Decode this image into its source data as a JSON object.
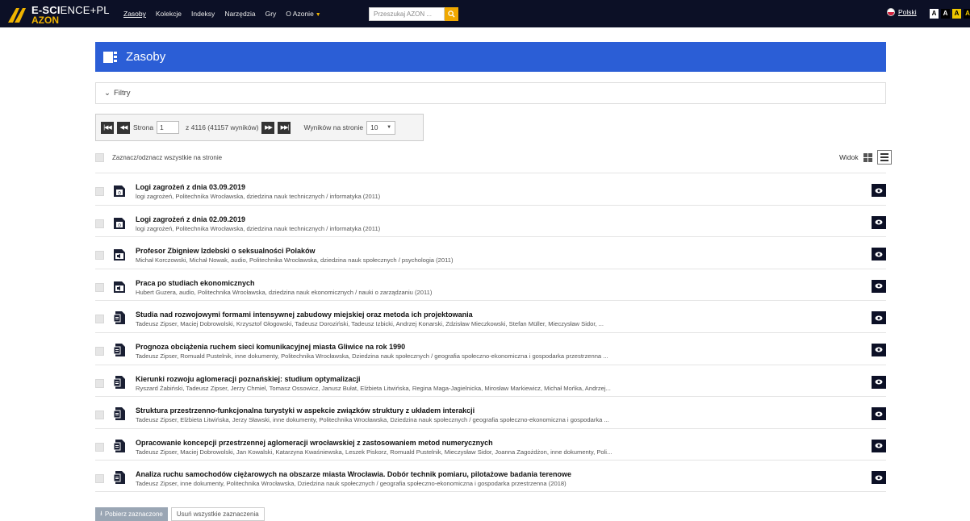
{
  "brand": {
    "name_bold": "E-SCI",
    "name_thin": "ENCE+PL",
    "sub": "AZON"
  },
  "nav": [
    {
      "label": "Zasoby",
      "active": true
    },
    {
      "label": "Kolekcje"
    },
    {
      "label": "Indeksy"
    },
    {
      "label": "Narzędzia"
    },
    {
      "label": "Gry"
    },
    {
      "label": "O Azonie"
    }
  ],
  "search": {
    "placeholder": "Przeszukaj AZON ..."
  },
  "language": "Polski",
  "font_sizes": [
    "A",
    "A",
    "A",
    "A"
  ],
  "section": {
    "title": "Zasoby"
  },
  "filters": {
    "label": "Filtry"
  },
  "pager": {
    "page_label": "Strona",
    "page_value": "1",
    "of_text": "z 4116 (41157 wyników)",
    "per_page_label": "Wyników na stronie",
    "per_page_value": "10"
  },
  "select_all": "Zaznacz/odznacz wszystkie na stronie",
  "view_label": "Widok",
  "results": [
    {
      "icon": "data-file-icon",
      "title": "Logi zagrożeń z dnia 03.09.2019",
      "meta": "logi zagrożeń, Politechnika Wrocławska, dziedzina nauk technicznych / informatyka (2011)"
    },
    {
      "icon": "data-file-icon",
      "title": "Logi zagrożeń z dnia 02.09.2019",
      "meta": "logi zagrożeń, Politechnika Wrocławska, dziedzina nauk technicznych / informatyka (2011)"
    },
    {
      "icon": "audio-file-icon",
      "title": "Profesor Zbigniew Izdebski o seksualności Polaków",
      "meta": "Michał Korczowski, Michał Nowak, audio, Politechnika Wrocławska, dziedzina nauk społecznych / psychologia (2011)"
    },
    {
      "icon": "audio-file-icon",
      "title": "Praca po studiach ekonomicznych",
      "meta": "Hubert Guzera, audio, Politechnika Wrocławska, dziedzina nauk ekonomicznych / nauki o zarządzaniu (2011)"
    },
    {
      "icon": "document-icon",
      "title": "Studia nad rozwojowymi formami intensywnej zabudowy miejskiej oraz metoda ich projektowania",
      "meta": "Tadeusz Zipser, Maciej Dobrowolski, Krzysztof Głogowski, Tadeusz Doroziński, Tadeusz Izbicki, Andrzej Konarski, Zdzisław Mieczkowski, Stefan Müller, Mieczysław Sidor, ..."
    },
    {
      "icon": "document-icon",
      "title": "Prognoza obciążenia ruchem sieci komunikacyjnej miasta Gliwice na rok 1990",
      "meta": "Tadeusz Zipser, Romuald Pustelnik, inne dokumenty, Politechnika Wrocławska, Dziedzina nauk społecznych / geografia społeczno-ekonomiczna i gospodarka przestrzenna ..."
    },
    {
      "icon": "document-icon",
      "title": "Kierunki rozwoju aglomeracji poznańskiej: studium optymalizacji",
      "meta": "Ryszard Żabiński, Tadeusz Zipser, Jerzy Chmiel, Tomasz Ossowicz, Janusz Bułat, Elżbieta Litwińska, Regina Maga-Jagielnicka, Mirosław Markiewicz, Michał Mońka, Andrzej..."
    },
    {
      "icon": "document-icon",
      "title": "Struktura przestrzenno-funkcjonalna turystyki w aspekcie związków struktury z układem interakcji",
      "meta": "Tadeusz Zipser, Elżbieta Litwińska, Jerzy Sławski, inne dokumenty, Politechnika Wrocławska, Dziedzina nauk społecznych / geografia społeczno-ekonomiczna i gospodarka ..."
    },
    {
      "icon": "document-icon",
      "title": "Opracowanie koncepcji przestrzennej aglomeracji wrocławskiej z zastosowaniem metod numerycznych",
      "meta": "Tadeusz Zipser, Maciej Dobrowolski, Jan Kowalski, Katarzyna Kwaśniewska, Leszek Piskorz, Romuald Pustelnik, Mieczysław Sidor, Joanna Zagożdżon, inne dokumenty, Poli..."
    },
    {
      "icon": "document-icon",
      "title": "Analiza ruchu samochodów ciężarowych na obszarze miasta Wrocławia. Dobór technik pomiaru, pilotażowe badania terenowe",
      "meta": "Tadeusz Zipser, inne dokumenty, Politechnika Wrocławska, Dziedzina nauk społecznych / geografia społeczno-ekonomiczna i gospodarka przestrzenna (2018)"
    }
  ],
  "bottom": {
    "download": "Pobierz zaznaczone",
    "clear": "Usuń wszystkie zaznaczenia"
  }
}
